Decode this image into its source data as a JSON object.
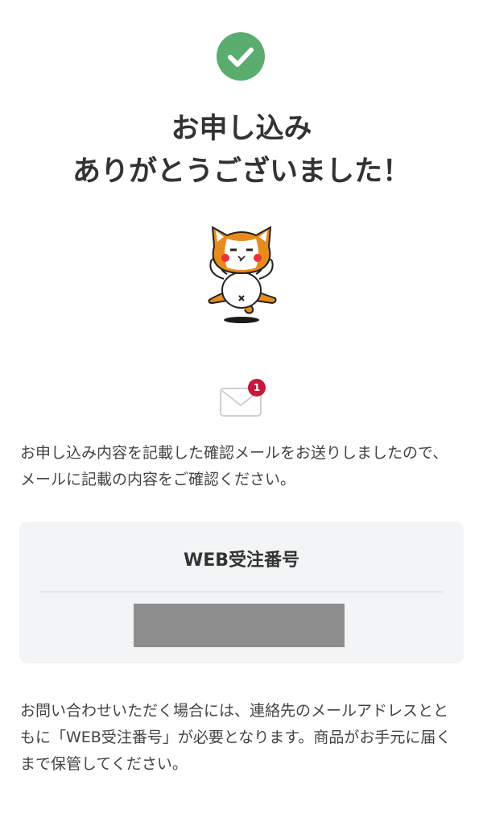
{
  "colors": {
    "success_green": "#5aad6f",
    "badge_red": "#c8173a",
    "text": "#333333",
    "panel_bg": "#f3f4f5",
    "redacted": "#8e8e8e"
  },
  "header": {
    "status_icon": "check-circle-icon",
    "title_line1": "お申し込み",
    "title_line2": "ありがとうございました！"
  },
  "mascot": {
    "icon": "cat-mascot-icon"
  },
  "mail": {
    "icon": "envelope-icon",
    "badge_count": "1",
    "message": "お申し込み内容を記載した確認メールをお送りしましたので、メールに記載の内容をご確認ください。"
  },
  "order": {
    "label": "WEB受注番号",
    "number": ""
  },
  "footer": {
    "note": "お問い合わせいただく場合には、連絡先のメールアドレスとともに「WEB受注番号」が必要となります。商品がお手元に届くまで保管してください。"
  }
}
